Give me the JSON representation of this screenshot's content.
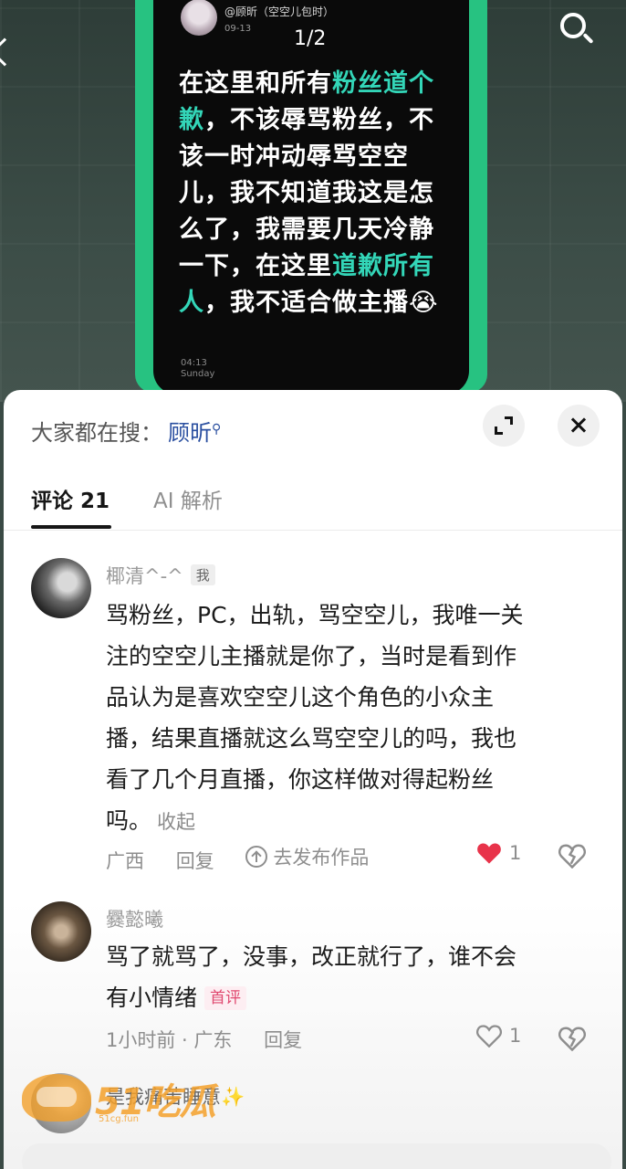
{
  "post": {
    "username": "@顾昕（空空儿包时）",
    "date": "09-13",
    "page_indicator": "1/2",
    "text_lines": [
      [
        {
          "t": "在这里和所有",
          "h": false
        },
        {
          "t": "粉丝道个",
          "h": true
        }
      ],
      [
        {
          "t": "歉",
          "h": true
        },
        {
          "t": "，不该辱骂粉丝，不",
          "h": false
        }
      ],
      [
        {
          "t": "该一时冲动辱骂空空",
          "h": false
        }
      ],
      [
        {
          "t": "儿，我不知道我这是怎",
          "h": false
        }
      ],
      [
        {
          "t": "么了，我需要几天冷静",
          "h": false
        }
      ],
      [
        {
          "t": "一下，在这里",
          "h": false
        },
        {
          "t": "道歉所有",
          "h": true
        }
      ],
      [
        {
          "t": "人",
          "h": true
        },
        {
          "t": "，我不适合做主播😭",
          "h": false
        }
      ]
    ],
    "time": "04:13",
    "day": "Sunday"
  },
  "sheet": {
    "search_prefix": "大家都在搜：",
    "search_keyword": "顾昕",
    "tabs": [
      {
        "label": "评论 21"
      },
      {
        "label": "AI 解析"
      }
    ]
  },
  "comments": [
    {
      "name": "椰清^-^",
      "badge": "我",
      "lines": [
        "骂粉丝，PC，出轨，骂空空儿，我唯一关",
        "注的空空儿主播就是你了，当时是看到作",
        "品认为是喜欢空空儿这个角色的小众主",
        "播，结果直播就这么骂空空儿的吗，我也",
        "看了几个月直播，你这样做对得起粉丝",
        "吗。"
      ],
      "fold": "收起",
      "location": "广西",
      "reply": "回复",
      "upload": "去发布作品",
      "likes": "1",
      "liked": true
    },
    {
      "name": "爨懿曦",
      "lines": [
        "骂了就骂了，没事，改正就行了，谁不会",
        "有小情绪"
      ],
      "first_badge": "首评",
      "time_location": "1小时前 · 广东",
      "reply": "回复",
      "likes": "1",
      "liked": false
    }
  ],
  "partial_comment": {
    "name": "是我痛苦睡意✨"
  },
  "watermark": {
    "text": "51吃瓜",
    "sub": "51cg.fun"
  },
  "colors": {
    "accent_teal": "#33d6b8",
    "phone_green": "#27c281",
    "like_red": "#e8334a",
    "keyword_blue": "#2a4fa0"
  }
}
